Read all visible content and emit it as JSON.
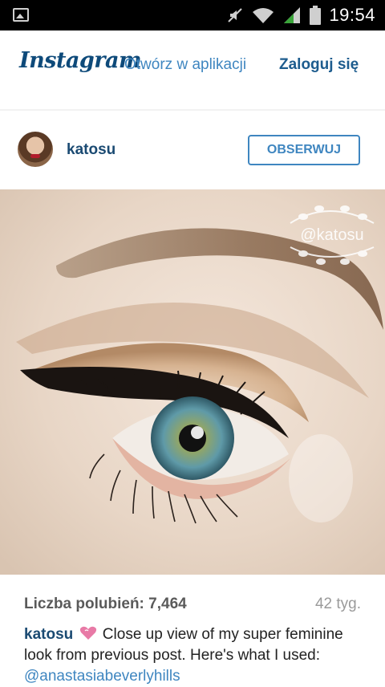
{
  "status_bar": {
    "time": "19:54"
  },
  "header": {
    "logo_text": "Instagram",
    "open_app_label": "Otwórz w aplikacji",
    "login_label": "Zaloguj się"
  },
  "post": {
    "username": "katosu",
    "follow_label": "OBSERWUJ",
    "watermark": "@katosu",
    "likes_label": "Liczba polubień: 7,464",
    "age": "42 tyg.",
    "caption_user": "katosu",
    "caption_text": " Close up view of my super feminine look from previous post. Here's what I used: ",
    "caption_mention": "@anastasiabeverlyhills"
  },
  "colors": {
    "brand": "#0e4a7a",
    "link": "#3f86c0",
    "username": "#1a4a72",
    "status_bar": "#000000"
  }
}
